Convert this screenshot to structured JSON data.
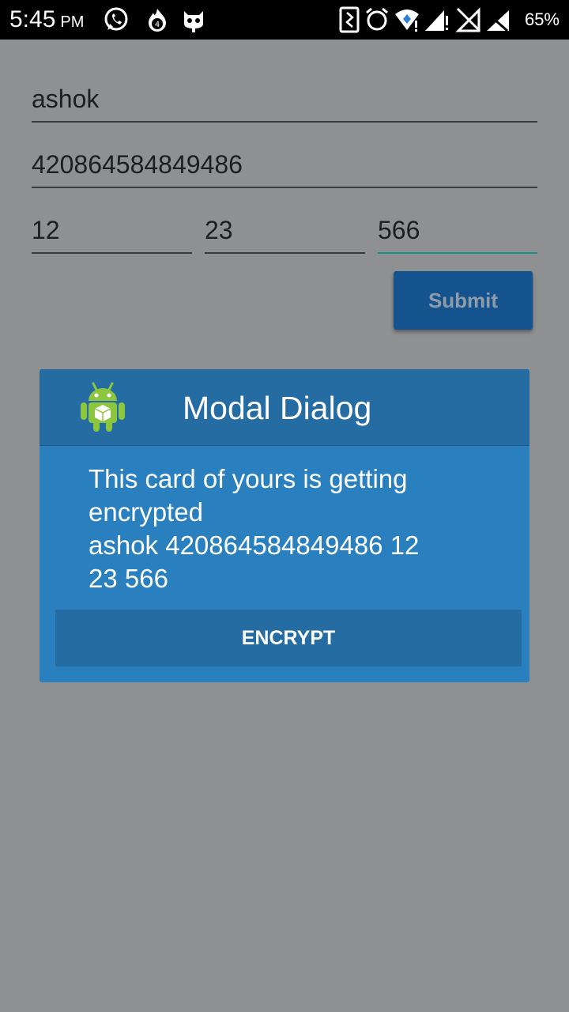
{
  "status_bar": {
    "time": "5:45",
    "ampm": "PM",
    "battery": "65%",
    "notification_icons": [
      "whatsapp-icon",
      "fire-app-icon",
      "cat-app-icon"
    ],
    "system_icons": [
      "phone-frame-icon",
      "alarm-icon",
      "wifi-icon",
      "signal-icon",
      "no-signal-icon",
      "sim-signal-icon"
    ],
    "notification_badge": "4"
  },
  "form": {
    "name_value": "ashok",
    "card_number_value": "420864584849486",
    "month_value": "12",
    "year_value": "23",
    "cvv_value": "566",
    "submit_label": "Submit"
  },
  "modal": {
    "title": "Modal Dialog",
    "icon": "android-icon",
    "message_lines": [
      "This card of yours is getting",
      "encrypted",
      "ashok 420864584849486 12",
      "23 566"
    ],
    "encrypt_label": "ENCRYPT"
  },
  "colors": {
    "background_dim": "#8e9092",
    "modal_header": "#246ca2",
    "modal_body": "#2a80bf",
    "submit_button": "#15538f",
    "active_underline": "#1a8e8a"
  }
}
